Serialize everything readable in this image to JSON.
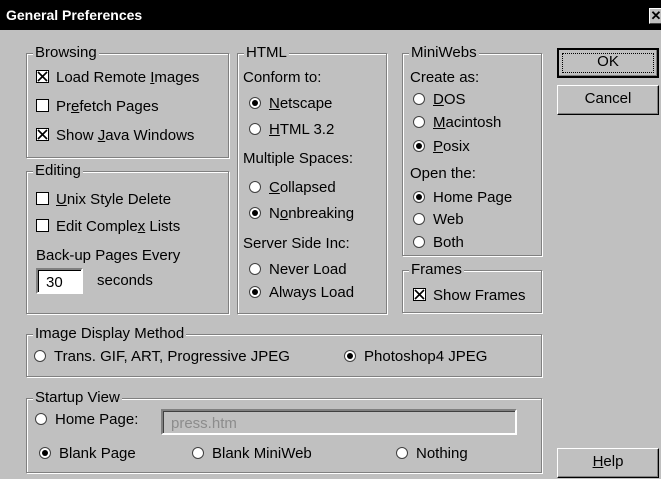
{
  "window": {
    "title": "General Preferences",
    "close_glyph": "✕"
  },
  "browsing": {
    "legend": "Browsing",
    "load_remote_images": {
      "pre": "Load Remote ",
      "key": "I",
      "post": "mages",
      "checked": true
    },
    "prefetch_pages": {
      "pre": "Pr",
      "key": "e",
      "post": "fetch Pages",
      "checked": false
    },
    "show_java_windows": {
      "pre": "Show ",
      "key": "J",
      "post": "ava Windows",
      "checked": true
    }
  },
  "editing": {
    "legend": "Editing",
    "unix_style_delete": {
      "pre": "",
      "key": "U",
      "post": "nix Style Delete",
      "checked": false
    },
    "edit_complex_lists": {
      "pre": "Edit Comple",
      "key": "x",
      "post": " Lists",
      "checked": false
    },
    "backup_label": "Back-up Pages Every",
    "backup_value": "30",
    "seconds_label": "seconds"
  },
  "html": {
    "legend": "HTML",
    "conform_label": "Conform to:",
    "netscape": {
      "pre": "",
      "key": "N",
      "post": "etscape",
      "selected": true
    },
    "html32": {
      "pre": "",
      "key": "H",
      "post": "TML 3.2",
      "selected": false
    },
    "spaces_label": "Multiple Spaces:",
    "collapsed": {
      "pre": "",
      "key": "C",
      "post": "ollapsed",
      "selected": false
    },
    "nonbreaking": {
      "pre": "N",
      "key": "o",
      "post": "nbreaking",
      "selected": true
    },
    "ssi_label": "Server Side Inc:",
    "never_load": {
      "label": "Never Load",
      "selected": false
    },
    "always_load": {
      "label": "Always Load",
      "selected": true
    }
  },
  "miniwebs": {
    "legend": "MiniWebs",
    "create_label": "Create as:",
    "dos": {
      "pre": "",
      "key": "D",
      "post": "OS",
      "selected": false
    },
    "macintosh": {
      "pre": "",
      "key": "M",
      "post": "acintosh",
      "selected": false
    },
    "posix": {
      "pre": "",
      "key": "P",
      "post": "osix",
      "selected": true
    },
    "open_label": "Open the:",
    "home_page": {
      "label": "Home Page",
      "selected": true
    },
    "web": {
      "label": "Web",
      "selected": false
    },
    "both": {
      "label": "Both",
      "selected": false
    }
  },
  "frames": {
    "legend": "Frames",
    "show_frames": {
      "label": "Show Frames",
      "checked": true
    }
  },
  "image_display": {
    "legend": "Image Display Method",
    "trans_gif": {
      "label": "Trans. GIF, ART, Progressive JPEG",
      "selected": false
    },
    "photoshop4": {
      "label": "Photoshop4 JPEG",
      "selected": true
    }
  },
  "startup_view": {
    "legend": "Startup View",
    "home_page": {
      "label": "Home Page:",
      "selected": false
    },
    "home_page_value": "press.htm",
    "blank_page": {
      "label": "Blank Page",
      "selected": true
    },
    "blank_miniweb": {
      "label": "Blank MiniWeb",
      "selected": false
    },
    "nothing": {
      "label": "Nothing",
      "selected": false
    }
  },
  "buttons": {
    "ok": "OK",
    "cancel": "Cancel",
    "help": {
      "pre": "",
      "key": "H",
      "post": "elp"
    }
  }
}
